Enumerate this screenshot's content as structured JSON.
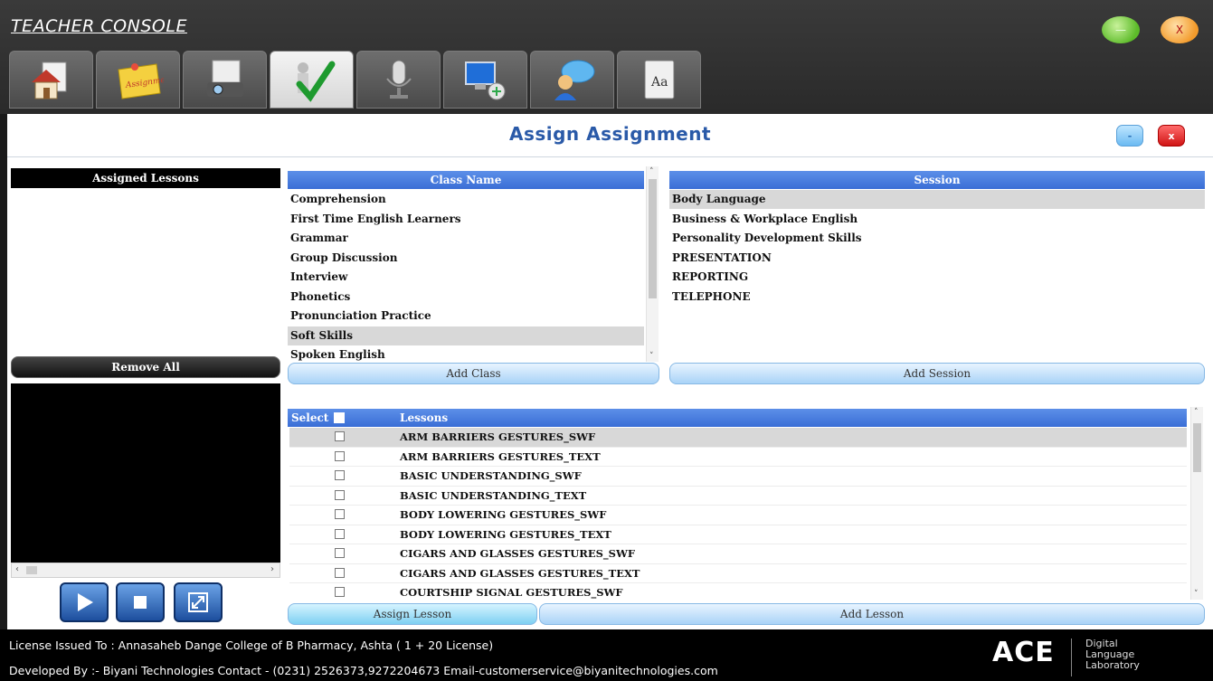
{
  "app": {
    "title": "TEACHER CONSOLE",
    "minimize_glyph": "—",
    "close_glyph": "X"
  },
  "tabs": [
    {
      "icon": "home-icon"
    },
    {
      "icon": "assignment-note-icon",
      "label": "Assignment"
    },
    {
      "icon": "projector-icon"
    },
    {
      "icon": "checkmark-teacher-icon",
      "active": true
    },
    {
      "icon": "microphone-icon"
    },
    {
      "icon": "network-computer-icon"
    },
    {
      "icon": "chat-user-icon"
    },
    {
      "icon": "dictionary-icon",
      "label": "Aa"
    }
  ],
  "header": {
    "title": "Assign Assignment",
    "minimize_glyph": "-",
    "close_glyph": "x"
  },
  "assigned": {
    "header": "Assigned Lessons",
    "remove_all": "Remove All",
    "items": []
  },
  "class_table": {
    "header": "Class Name",
    "rows": [
      "Comprehension",
      "First Time English Learners",
      "Grammar",
      "Group Discussion",
      "Interview",
      "Phonetics",
      "Pronunciation Practice",
      "Soft Skills",
      "Spoken English"
    ],
    "selected": "Soft Skills",
    "add_button": "Add Class"
  },
  "session_table": {
    "header": "Session",
    "rows": [
      "Body Language",
      "Business & Workplace English",
      "Personality Development Skills",
      "PRESENTATION",
      "REPORTING",
      "TELEPHONE"
    ],
    "selected": "Body Language",
    "add_button": "Add Session"
  },
  "lessons_table": {
    "select_header": "Select",
    "lessons_header": "Lessons",
    "rows": [
      "ARM BARRIERS GESTURES_SWF",
      "ARM BARRIERS GESTURES_TEXT",
      "BASIC UNDERSTANDING_SWF",
      "BASIC UNDERSTANDING_TEXT",
      "BODY LOWERING GESTURES_SWF",
      "BODY LOWERING GESTURES_TEXT",
      "CIGARS AND GLASSES GESTURES_SWF",
      "CIGARS AND GLASSES GESTURES_TEXT",
      "COURTSHIP SIGNAL GESTURES_SWF"
    ],
    "highlighted_index": 0,
    "assign_button": "Assign Lesson",
    "add_button": "Add Lesson"
  },
  "footer": {
    "license": "License Issued To :   Annasaheb Dange College of B Pharmacy, Ashta ( 1 + 20 License)",
    "developer": "Developed By :- Biyani Technologies   Contact - (0231) 2526373,9272204673  Email-customerservice@biyanitechnologies.com",
    "logo": "ACE",
    "logo_sub": [
      "Digital",
      "Language",
      "Laboratory"
    ]
  },
  "colors": {
    "table_header": "#3a6ed6",
    "title_blue": "#2a5aa8",
    "selected_row": "#d8d8d8"
  }
}
